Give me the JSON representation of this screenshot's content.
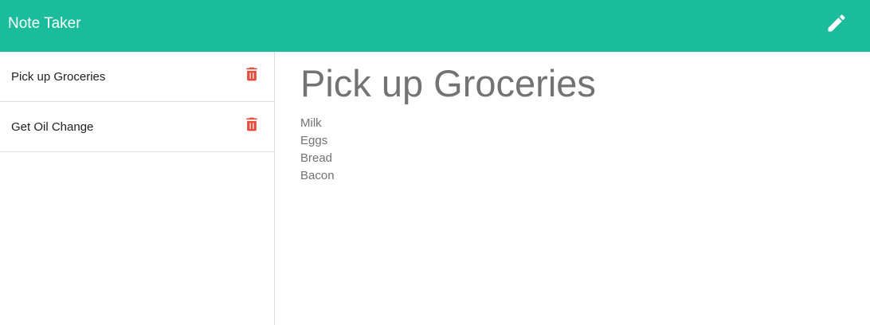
{
  "navbar": {
    "title": "Note Taker",
    "new_note_icon": "pencil-icon",
    "background": "#1abc9c"
  },
  "notes": [
    {
      "title": "Pick up Groceries",
      "delete_icon": "trash-icon"
    },
    {
      "title": "Get Oil Change",
      "delete_icon": "trash-icon"
    }
  ],
  "active_note": {
    "title": "Pick up Groceries",
    "lines": [
      "Milk",
      "Eggs",
      "Bread",
      "Bacon"
    ]
  },
  "colors": {
    "accent": "#1abc9c",
    "delete": "#e74c3c",
    "note_text": "#737373"
  }
}
